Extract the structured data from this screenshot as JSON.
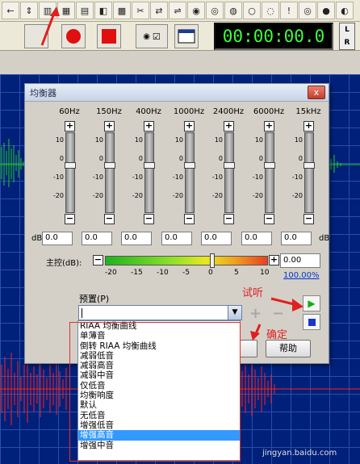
{
  "dialog": {
    "title": "均衡器",
    "close_label": "x",
    "bands": [
      {
        "label": "60Hz",
        "value": "0.0"
      },
      {
        "label": "150Hz",
        "value": "0.0"
      },
      {
        "label": "400Hz",
        "value": "0.0"
      },
      {
        "label": "1000Hz",
        "value": "0.0"
      },
      {
        "label": "2400Hz",
        "value": "0.0"
      },
      {
        "label": "6000Hz",
        "value": "0.0"
      },
      {
        "label": "15kHz",
        "value": "0.0"
      }
    ],
    "slider_ticks": [
      "10",
      "0",
      "-10",
      "-20"
    ],
    "db_unit": "dB",
    "master_label": "主控(dB):",
    "master_value": "0.00",
    "master_scale": [
      "-20",
      "-15",
      "-10",
      "-5",
      "0",
      "5",
      "10"
    ],
    "percent_link": "100.00%",
    "preset_label": "预置(P)",
    "preset_value": "",
    "help_button": "帮助",
    "ok_button": ""
  },
  "preset_options": [
    "RIAA 均衡曲线",
    "单薄音",
    "倒转 RIAA 均衡曲线",
    "减弱低音",
    "减弱高音",
    "减弱中音",
    "仅低音",
    "均衡响度",
    "默认",
    "无低音",
    "增强低音",
    "增强高音",
    "增强中音"
  ],
  "selected_preset": "增强高音",
  "annotations": {
    "listen": "试听",
    "confirm": "确定"
  },
  "timer": "00:00:00.0",
  "lr_labels": [
    "L",
    "R"
  ],
  "watermark": "jingyan.baidu.com",
  "colors": {
    "wave_background": "#00207a",
    "waveform_green": "#22cc22",
    "waveform_red": "#ff2020",
    "annotation_red": "#e02020",
    "selected_item": "#3399ff"
  }
}
